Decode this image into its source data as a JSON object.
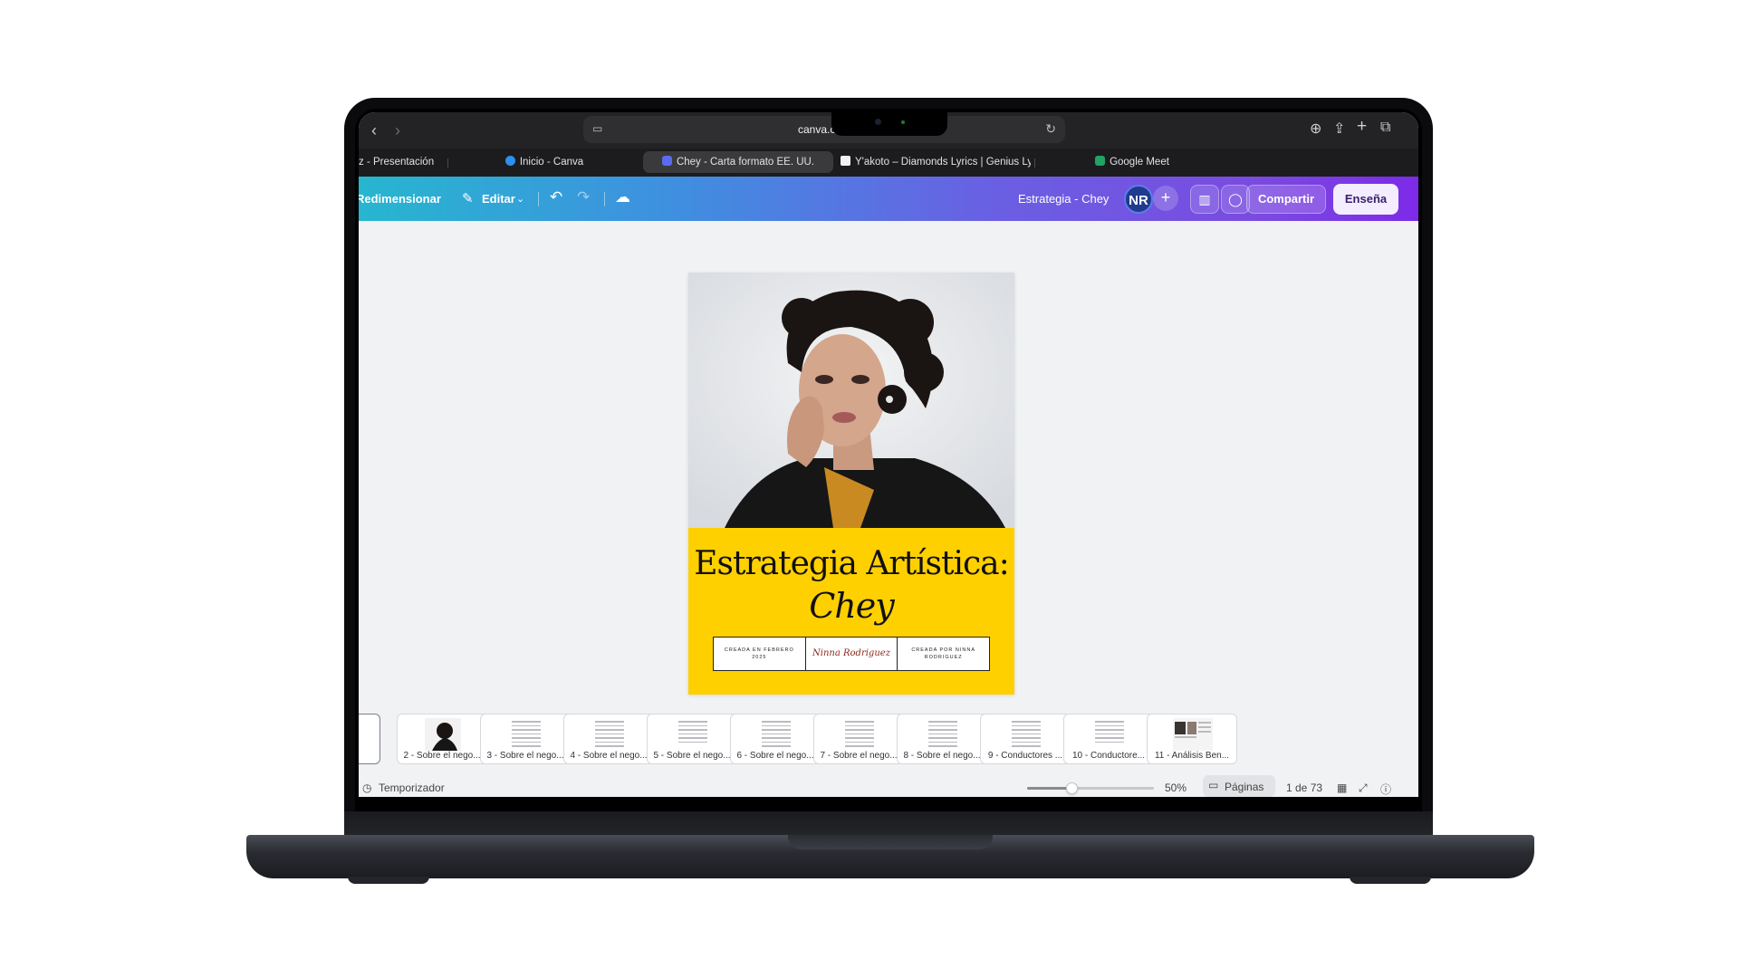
{
  "browser": {
    "url": "canva.com",
    "tabs": [
      {
        "label": "z - Presentación"
      },
      {
        "label": "Inicio - Canva"
      },
      {
        "label": "Chey - Carta formato EE. UU."
      },
      {
        "label": "Y'akoto – Diamonds Lyrics | Genius Ly..."
      },
      {
        "label": "Google Meet"
      }
    ]
  },
  "toolbar": {
    "resize_label": "Redimensionar",
    "edit_label": "Editar",
    "doc_title": "Estrategia - Chey",
    "avatar_initials": "NR",
    "share_label": "Compartir",
    "teach_label": "Enseña"
  },
  "page": {
    "title_line1": "Estrategia Artística:",
    "title_line2": "Chey",
    "info_left": "CREADA EN FEBRERO 2025",
    "info_signature": "Ninna Rodriguez",
    "info_right": "CREADA POR NINNA RODRIGUEZ"
  },
  "thumbnails": [
    {
      "label": "2 - Sobre el nego..."
    },
    {
      "label": "3 - Sobre el nego..."
    },
    {
      "label": "4 - Sobre el nego..."
    },
    {
      "label": "5 - Sobre el nego..."
    },
    {
      "label": "6 - Sobre el nego..."
    },
    {
      "label": "7 - Sobre el nego..."
    },
    {
      "label": "8 - Sobre el nego..."
    },
    {
      "label": "9 - Conductores ..."
    },
    {
      "label": "10 - Conductore..."
    },
    {
      "label": "11 - Análisis Ben..."
    }
  ],
  "footer": {
    "timer_label": "Temporizador",
    "zoom_level": "50%",
    "zoom_fraction": 0.35,
    "pages_label": "Páginas",
    "page_counter": "1 de 73"
  },
  "colors": {
    "canva_gradient_start": "#27b6cf",
    "canva_gradient_end": "#7d2ae8",
    "page_background": "#ffd000"
  }
}
